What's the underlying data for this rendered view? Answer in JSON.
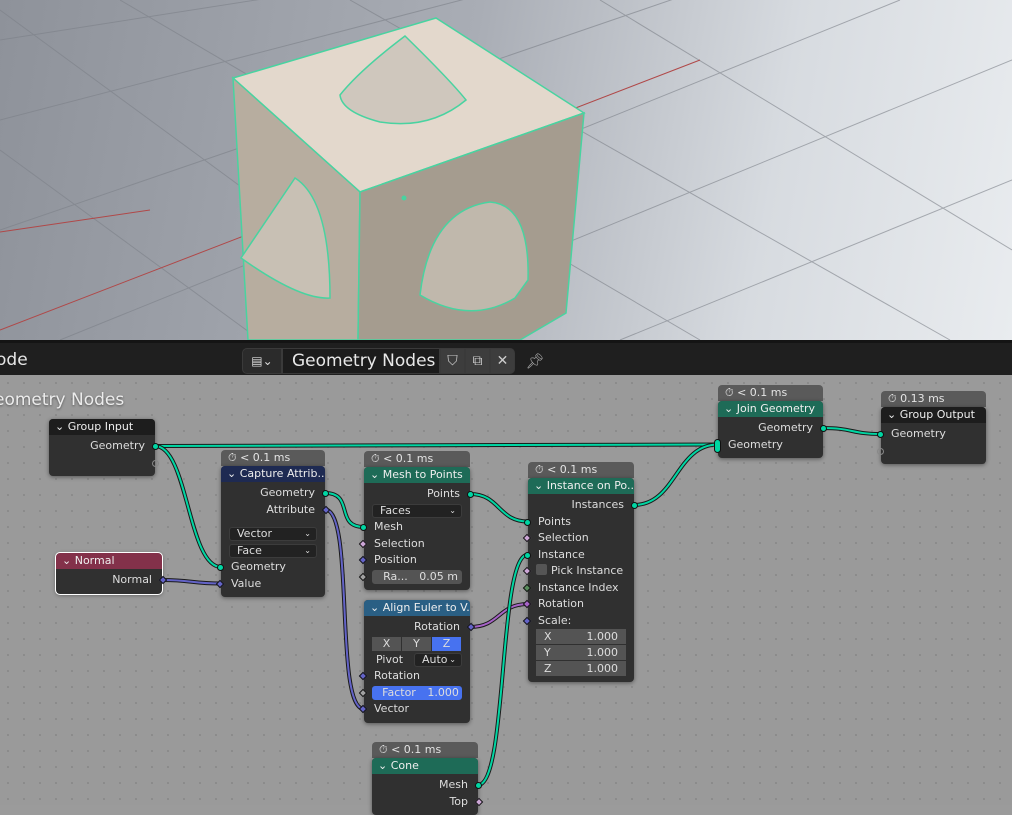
{
  "header": {
    "editor_label": "ode",
    "nodegroup_type_icon": "node-tree-icon",
    "nodegroup_name": "Geometry Nodes",
    "fake_user_icon": "shield-icon",
    "duplicate_icon": "duplicate-icon",
    "close_icon": "close-icon",
    "pin_icon": "pin-icon"
  },
  "editor": {
    "tree_title": "eometry Nodes"
  },
  "colors": {
    "geometry_socket": "#00d6a3",
    "vector_socket": "#6363c7",
    "float_socket": "#a1a1a1",
    "bool_socket": "#cca6d6",
    "int_socket": "#598c5c",
    "rotation_socket": "#a663c7",
    "link_geometry": "#00d6a3"
  },
  "nodes": [
    {
      "id": "group_input",
      "title": "Group Input",
      "header": "#1d1d1d",
      "rows": [
        {
          "t": "out",
          "label": "Geometry",
          "s": "geometry_socket"
        },
        {
          "t": "out",
          "label": "",
          "s": "float_socket",
          "hollow": true
        }
      ]
    },
    {
      "id": "normal",
      "title": "Normal",
      "header": "#83314a",
      "selected": true,
      "rows": [
        {
          "t": "out",
          "label": "Normal",
          "s": "vector_socket",
          "d": true
        }
      ]
    },
    {
      "id": "capture",
      "title": "Capture Attrib...",
      "header": "#1e2a52",
      "time": "< 0.1 ms",
      "rows": [
        {
          "t": "out",
          "label": "Geometry",
          "s": "geometry_socket"
        },
        {
          "t": "out",
          "label": "Attribute",
          "s": "vector_socket",
          "d": true
        },
        {
          "t": "gap"
        },
        {
          "t": "select",
          "label": "Vector"
        },
        {
          "t": "select",
          "label": "Face"
        },
        {
          "t": "in",
          "label": "Geometry",
          "s": "geometry_socket"
        },
        {
          "t": "in",
          "label": "Value",
          "s": "vector_socket",
          "d": true
        }
      ]
    },
    {
      "id": "mesh_to_points",
      "title": "Mesh to Points",
      "header": "#1e6b57",
      "time": "< 0.1 ms",
      "rows": [
        {
          "t": "out",
          "label": "Points",
          "s": "geometry_socket"
        },
        {
          "t": "select",
          "label": "Faces"
        },
        {
          "t": "in",
          "label": "Mesh",
          "s": "geometry_socket"
        },
        {
          "t": "in",
          "label": "Selection",
          "s": "bool_socket",
          "d": true
        },
        {
          "t": "in",
          "label": "Position",
          "s": "vector_socket",
          "d": true
        },
        {
          "t": "field",
          "label": "Ra...",
          "value": "0.05 m",
          "s": "float_socket",
          "d": true
        }
      ]
    },
    {
      "id": "align_euler",
      "title": "Align Euler to V...",
      "header": "#2a5f84",
      "rows": [
        {
          "t": "out",
          "label": "Rotation",
          "s": "vector_socket",
          "d": true
        },
        {
          "t": "xyz",
          "options": [
            "X",
            "Y",
            "Z"
          ],
          "active": "Z"
        },
        {
          "t": "pivot",
          "label": "Pivot",
          "value": "Auto"
        },
        {
          "t": "in",
          "label": "Rotation",
          "s": "vector_socket",
          "d": true
        },
        {
          "t": "field",
          "label": "Factor",
          "value": "1.000",
          "s": "float_socket",
          "d": true,
          "blue": true
        },
        {
          "t": "in",
          "label": "Vector",
          "s": "vector_socket",
          "d": true
        }
      ]
    },
    {
      "id": "instance_on_points",
      "title": "Instance on Po...",
      "header": "#1e6b57",
      "time": "< 0.1 ms",
      "rows": [
        {
          "t": "out",
          "label": "Instances",
          "s": "geometry_socket"
        },
        {
          "t": "in",
          "label": "Points",
          "s": "geometry_socket"
        },
        {
          "t": "in",
          "label": "Selection",
          "s": "bool_socket",
          "d": true
        },
        {
          "t": "in",
          "label": "Instance",
          "s": "geometry_socket"
        },
        {
          "t": "check",
          "label": "Pick Instance",
          "s": "bool_socket",
          "d": true
        },
        {
          "t": "in",
          "label": "Instance Index",
          "s": "int_socket",
          "d": true
        },
        {
          "t": "in",
          "label": "Rotation",
          "s": "rotation_socket",
          "d": true
        },
        {
          "t": "in",
          "label": "Scale:",
          "s": "vector_socket",
          "d": true
        },
        {
          "t": "vec",
          "label": "X",
          "value": "1.000"
        },
        {
          "t": "vec",
          "label": "Y",
          "value": "1.000"
        },
        {
          "t": "vec",
          "label": "Z",
          "value": "1.000"
        }
      ]
    },
    {
      "id": "join_geometry",
      "title": "Join Geometry",
      "header": "#1e6b57",
      "time": "< 0.1 ms",
      "rows": [
        {
          "t": "out",
          "label": "Geometry",
          "s": "geometry_socket"
        },
        {
          "t": "in",
          "label": "Geometry",
          "s": "geometry_socket",
          "multi": true
        }
      ]
    },
    {
      "id": "group_output",
      "title": "Group Output",
      "header": "#1d1d1d",
      "time": "0.13 ms",
      "rows": [
        {
          "t": "in",
          "label": "Geometry",
          "s": "geometry_socket"
        },
        {
          "t": "in",
          "label": "",
          "s": "float_socket",
          "hollow": true
        }
      ]
    },
    {
      "id": "cone",
      "title": "Cone",
      "header": "#1e6b57",
      "time": "< 0.1 ms",
      "rows": [
        {
          "t": "out",
          "label": "Mesh",
          "s": "geometry_socket"
        },
        {
          "t": "out",
          "label": "Top",
          "s": "bool_socket",
          "d": true
        }
      ]
    }
  ]
}
